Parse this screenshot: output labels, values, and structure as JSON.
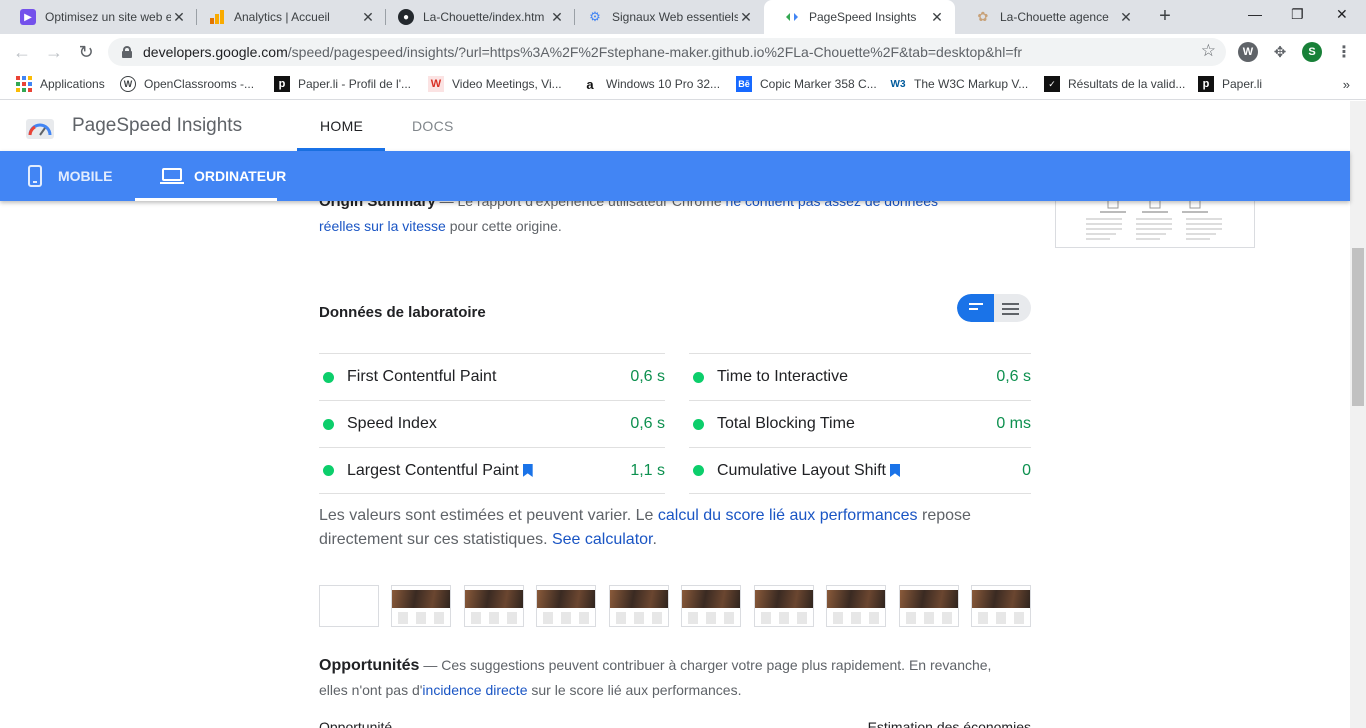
{
  "browser": {
    "tabs": [
      {
        "title": "Optimisez un site web e",
        "icon": "openclassrooms-icon",
        "color": "#7451eb"
      },
      {
        "title": "Analytics | Accueil",
        "icon": "analytics-icon",
        "color": "#f9ab00"
      },
      {
        "title": "La-Chouette/index.htm",
        "icon": "github-icon",
        "color": "#24292e"
      },
      {
        "title": "Signaux Web essentiels",
        "icon": "web-vitals-icon",
        "color": "#4285f4"
      },
      {
        "title": "PageSpeed Insights",
        "icon": "pagespeed-icon",
        "color": "#34a853"
      },
      {
        "title": "La-Chouette agence",
        "icon": "owl-icon",
        "color": "#c8a27a"
      }
    ],
    "url_host": "developers.google.com",
    "url_path": "/speed/pagespeed/insights/?url=https%3A%2F%2Fstephane-maker.github.io%2FLa-Chouette%2F&tab=desktop&hl=fr",
    "profile_initial": "S",
    "bookmarks": [
      {
        "label": "Applications",
        "icon": "apps-icon"
      },
      {
        "label": "OpenClassrooms -...",
        "icon": "wordpress-icon"
      },
      {
        "label": "Paper.li - Profil de l'...",
        "icon": "paperli-icon"
      },
      {
        "label": "Video Meetings, Vi...",
        "icon": "whereby-icon"
      },
      {
        "label": "Windows 10 Pro 32...",
        "icon": "amazon-icon"
      },
      {
        "label": "Copic Marker 358 C...",
        "icon": "behance-icon"
      },
      {
        "label": "The W3C Markup V...",
        "icon": "w3c-icon"
      },
      {
        "label": "Résultats de la valid...",
        "icon": "validator-icon"
      },
      {
        "label": "Paper.li",
        "icon": "paperli-icon"
      }
    ]
  },
  "header": {
    "title": "PageSpeed Insights",
    "nav": [
      "HOME",
      "DOCS"
    ]
  },
  "device_tabs": {
    "mobile": "MOBILE",
    "desktop": "ORDINATEUR"
  },
  "origin": {
    "heading": "Origin Summary",
    "dash": " — ",
    "text1": "Le rapport d'expérience utilisateur Chrome ",
    "link": "ne contient pas assez de données réelles sur la vitesse",
    "text2": " pour cette origine."
  },
  "lab": {
    "title": "Données de laboratoire",
    "metrics_left": [
      {
        "name": "First Contentful Paint",
        "value": "0,6 s",
        "flag": false
      },
      {
        "name": "Speed Index",
        "value": "0,6 s",
        "flag": false
      },
      {
        "name": "Largest Contentful Paint",
        "value": "1,1 s",
        "flag": true
      }
    ],
    "metrics_right": [
      {
        "name": "Time to Interactive",
        "value": "0,6 s",
        "flag": false
      },
      {
        "name": "Total Blocking Time",
        "value": "0 ms",
        "flag": false
      },
      {
        "name": "Cumulative Layout Shift",
        "value": "0",
        "flag": true
      }
    ],
    "note_text1": "Les valeurs sont estimées et peuvent varier. Le ",
    "note_link1": "calcul du score lié aux performances",
    "note_text2": " repose directement sur ces statistiques. ",
    "note_link2": "See calculator",
    "note_text3": "."
  },
  "opportunities": {
    "heading": "Opportunités",
    "dash": " — ",
    "text1": "Ces suggestions peuvent contribuer à charger votre page plus rapidement. En revanche, elles n'ont pas d'",
    "link": "incidence directe",
    "text2": " sur le score lié aux performances.",
    "col_left": "Opportunité",
    "col_right": "Estimation des économies"
  },
  "colors": {
    "brand_blue": "#4285f4",
    "pass_green": "#0cce6b",
    "value_green": "#0d904f",
    "link_blue": "#1a55c4"
  }
}
